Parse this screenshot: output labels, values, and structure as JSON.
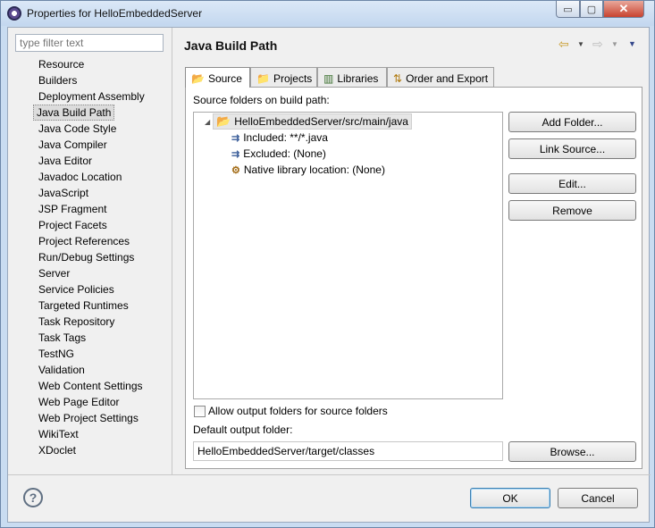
{
  "window": {
    "title": "Properties for HelloEmbeddedServer",
    "minimize_glyph": "▭",
    "maximize_glyph": "▢",
    "close_glyph": "✕"
  },
  "sidebar": {
    "filter_placeholder": "type filter text",
    "items": [
      {
        "label": "Resource"
      },
      {
        "label": "Builders"
      },
      {
        "label": "Deployment Assembly"
      },
      {
        "label": "Java Build Path"
      },
      {
        "label": "Java Code Style"
      },
      {
        "label": "Java Compiler"
      },
      {
        "label": "Java Editor"
      },
      {
        "label": "Javadoc Location"
      },
      {
        "label": "JavaScript"
      },
      {
        "label": "JSP Fragment"
      },
      {
        "label": "Project Facets"
      },
      {
        "label": "Project References"
      },
      {
        "label": "Run/Debug Settings"
      },
      {
        "label": "Server"
      },
      {
        "label": "Service Policies"
      },
      {
        "label": "Targeted Runtimes"
      },
      {
        "label": "Task Repository"
      },
      {
        "label": "Task Tags"
      },
      {
        "label": "TestNG"
      },
      {
        "label": "Validation"
      },
      {
        "label": "Web Content Settings"
      },
      {
        "label": "Web Page Editor"
      },
      {
        "label": "Web Project Settings"
      },
      {
        "label": "WikiText"
      },
      {
        "label": "XDoclet"
      }
    ],
    "selected": "Java Build Path"
  },
  "header": {
    "title": "Java Build Path",
    "back_glyph": "⇦",
    "forward_glyph": "⇨",
    "dropdown_glyph": "▼"
  },
  "tabs": [
    {
      "label": "Source",
      "icon": "source-folder-icon"
    },
    {
      "label": "Projects",
      "icon": "projects-icon"
    },
    {
      "label": "Libraries",
      "icon": "libraries-icon"
    },
    {
      "label": "Order and Export",
      "icon": "order-export-icon"
    }
  ],
  "source": {
    "section_label": "Source folders on build path:",
    "root": "HelloEmbeddedServer/src/main/java",
    "children": [
      {
        "label": "Included: **/*.java",
        "icon": "inclusion-filter-icon"
      },
      {
        "label": "Excluded: (None)",
        "icon": "exclusion-filter-icon"
      },
      {
        "label": "Native library location: (None)",
        "icon": "native-library-icon"
      }
    ],
    "allow_output_label": "Allow output folders for source folders",
    "allow_output_checked": false,
    "default_output_label": "Default output folder:",
    "default_output_value": "HelloEmbeddedServer/target/classes"
  },
  "buttons": {
    "add_folder": "Add Folder...",
    "link_source": "Link Source...",
    "edit": "Edit...",
    "remove": "Remove",
    "browse": "Browse...",
    "ok": "OK",
    "cancel": "Cancel",
    "help": "?"
  }
}
